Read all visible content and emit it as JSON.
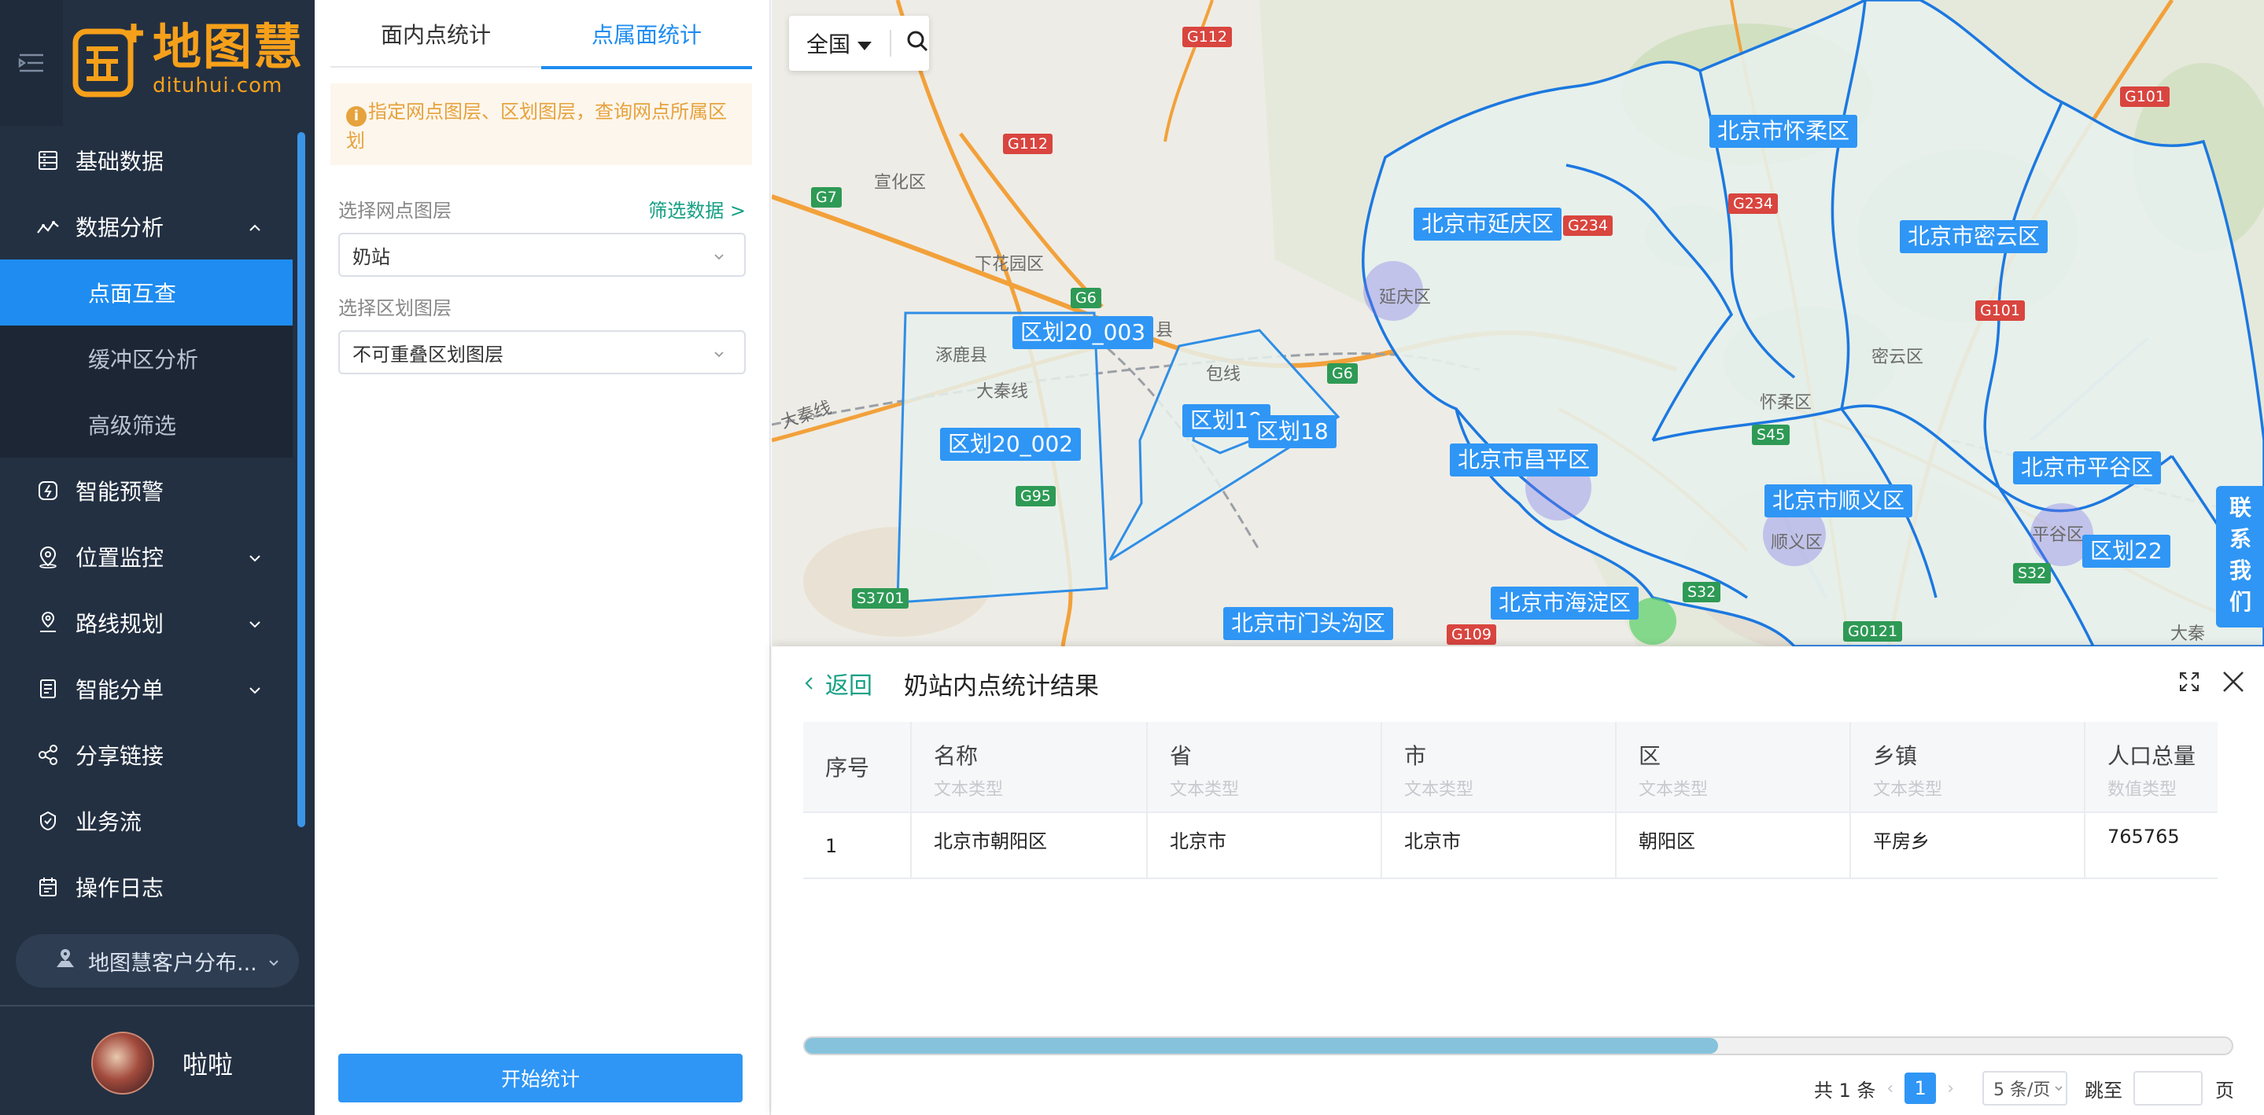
{
  "brand": {
    "logo_cn": "地图慧",
    "logo_en": "dituhui.com"
  },
  "nav": {
    "items": [
      {
        "label": "基础数据",
        "icon": "database-icon"
      },
      {
        "label": "数据分析",
        "icon": "analysis-icon",
        "expanded": true
      },
      {
        "label": "智能预警",
        "icon": "alert-icon"
      },
      {
        "label": "位置监控",
        "icon": "location-icon"
      },
      {
        "label": "路线规划",
        "icon": "route-icon"
      },
      {
        "label": "智能分单",
        "icon": "dispatch-icon"
      },
      {
        "label": "分享链接",
        "icon": "share-icon"
      },
      {
        "label": "业务流",
        "icon": "workflow-icon"
      },
      {
        "label": "操作日志",
        "icon": "log-icon"
      }
    ],
    "sub_items": [
      {
        "label": "点面互查",
        "active": true
      },
      {
        "label": "缓冲区分析",
        "active": false
      },
      {
        "label": "高级筛选",
        "active": false
      }
    ],
    "workspace": "地图慧客户分布...",
    "user_name": "啦啦"
  },
  "panel": {
    "tabs": [
      {
        "label": "面内点统计",
        "active": false
      },
      {
        "label": "点属面统计",
        "active": true
      }
    ],
    "notice": "指定网点图层、区划图层，查询网点所属区划",
    "point_layer_label": "选择网点图层",
    "filter_link": "筛选数据 >",
    "point_layer_value": "奶站",
    "region_layer_label": "选择区划图层",
    "region_layer_value": "不可重叠区划图层",
    "start_button": "开始统计"
  },
  "map": {
    "region_select": "全国",
    "district_labels": [
      "北京市怀柔区",
      "北京市延庆区",
      "北京市密云区",
      "北京市昌平区",
      "北京市顺义区",
      "北京市平谷区",
      "北京市海淀区",
      "北京市门头沟区",
      "区划20_003",
      "区划20_002",
      "区划19",
      "区划18",
      "区划22"
    ],
    "road_badges": [
      "G112",
      "G112",
      "G7",
      "G6",
      "G6",
      "G95",
      "S3701",
      "G234",
      "G234",
      "G101",
      "G101",
      "S45",
      "S32",
      "S32",
      "G109",
      "G0121"
    ],
    "places": [
      "宣化区",
      "下花园区",
      "涿鹿县",
      "延庆区",
      "密云区",
      "怀柔区",
      "顺义区",
      "平谷区",
      "大秦线",
      "大秦线",
      "包线",
      "县",
      "大秦"
    ],
    "contact": "联系我们",
    "colors": {
      "district_fill": "#e7f1ec",
      "district_border": "#1c78e0",
      "label_bg": "#2f96f5"
    }
  },
  "result": {
    "back_label": "返回",
    "title": "奶站内点统计结果",
    "columns": [
      {
        "title": "序号",
        "type": ""
      },
      {
        "title": "名称",
        "type": "文本类型"
      },
      {
        "title": "省",
        "type": "文本类型"
      },
      {
        "title": "市",
        "type": "文本类型"
      },
      {
        "title": "区",
        "type": "文本类型"
      },
      {
        "title": "乡镇",
        "type": "文本类型"
      },
      {
        "title": "人口总量",
        "type": "数值类型"
      }
    ],
    "rows": [
      [
        "1",
        "北京市朝阳区",
        "北京市",
        "北京市",
        "朝阳区",
        "平房乡",
        "765765"
      ]
    ],
    "scroll_fraction": 0.64,
    "pagination": {
      "total": "共 1 条",
      "current_page": "1",
      "page_size": "5 条/页",
      "jump_label": "跳至",
      "unit": "页"
    }
  }
}
